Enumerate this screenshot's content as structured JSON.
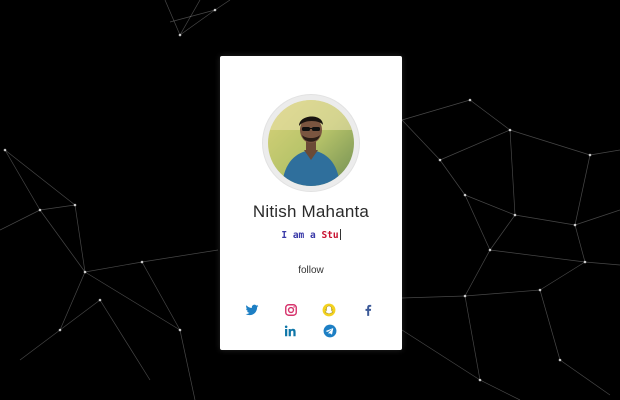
{
  "profile": {
    "name": "Nitish Mahanta",
    "typing_prefix": "I am a ",
    "typing_highlight": "Stu",
    "follow_label": "follow"
  },
  "social_icons": [
    {
      "name": "twitter-icon",
      "color": "#1d7fc4"
    },
    {
      "name": "instagram-icon",
      "color": "#d6336c"
    },
    {
      "name": "snapchat-icon",
      "color": "#e8c21a"
    },
    {
      "name": "facebook-icon",
      "color": "#3b5998"
    },
    {
      "name": "linkedin-icon",
      "color": "#0e76a8"
    },
    {
      "name": "telegram-icon",
      "color": "#1d7fc4"
    }
  ],
  "colors": {
    "background": "#000000",
    "card": "#ffffff",
    "typing_text": "#3a3aa8",
    "typing_highlight": "#c8102e"
  }
}
